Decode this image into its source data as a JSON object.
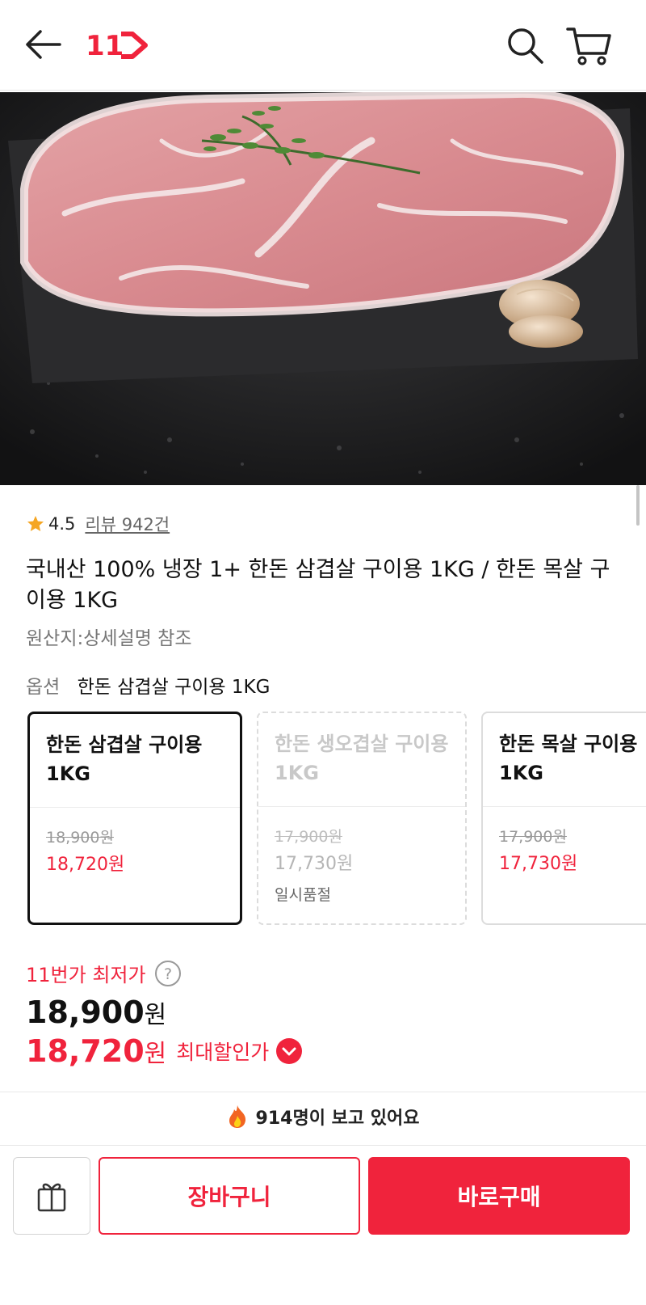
{
  "header": {
    "logo_text": "11",
    "colors": {
      "brand": "#f0233c"
    },
    "icons": [
      "back-arrow-icon",
      "search-icon",
      "cart-icon"
    ]
  },
  "gallery": {
    "slide_count": 2,
    "active_slide": 2
  },
  "product": {
    "rating": "4.5",
    "review_link": "리뷰 942건",
    "title": "국내산 100% 냉장 1+ 한돈 삼겹살 구이용 1KG / 한돈 목살 구이용 1KG",
    "origin": "원산지:상세설명 참조",
    "option_label": "옵션",
    "option_selected": "한돈 삼겹살 구이용 1KG"
  },
  "options": [
    {
      "name": "한돈 삼겹살 구이용 1KG",
      "original_price": "18,900원",
      "sale_price": "18,720원",
      "state": "selected"
    },
    {
      "name": "한돈 생오겹살 구이용 1KG",
      "original_price": "17,900원",
      "sale_price": "17,730원",
      "state": "sold_out",
      "status": "일시품절"
    },
    {
      "name": "한돈 목살 구이용 1KG",
      "original_price": "17,900원",
      "sale_price": "17,730원",
      "state": "available"
    }
  ],
  "pricing": {
    "lowest_label": "11번가 최저가",
    "original_amount": "18,900",
    "sale_amount": "18,720",
    "currency": "원",
    "max_discount_label": "최대할인가"
  },
  "viewers": {
    "text": "914명이 보고 있어요"
  },
  "bottom_bar": {
    "cart_label": "장바구니",
    "buy_label": "바로구매"
  }
}
